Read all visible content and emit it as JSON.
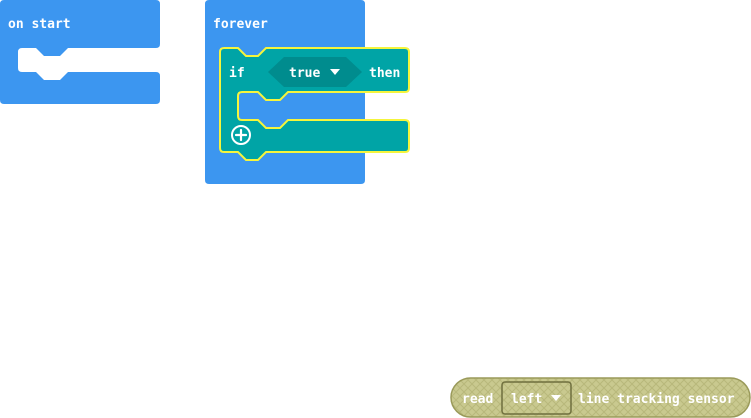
{
  "blocks": {
    "on_start": {
      "label": "on start",
      "color": "#3C96F0"
    },
    "forever": {
      "label": "forever",
      "color": "#3C96F0"
    },
    "if_block": {
      "if_label": "if",
      "then_label": "then",
      "color": "#00A4A6",
      "highlight_color": "#F5F53C",
      "condition_value": "true",
      "add_icon": "plus-circle-icon"
    },
    "read_sensor": {
      "read_label": "read",
      "side_value": "left",
      "suffix_label": "line tracking sensor",
      "color": "#C8C88C",
      "dropdown_icon": "caret-down-icon"
    }
  }
}
